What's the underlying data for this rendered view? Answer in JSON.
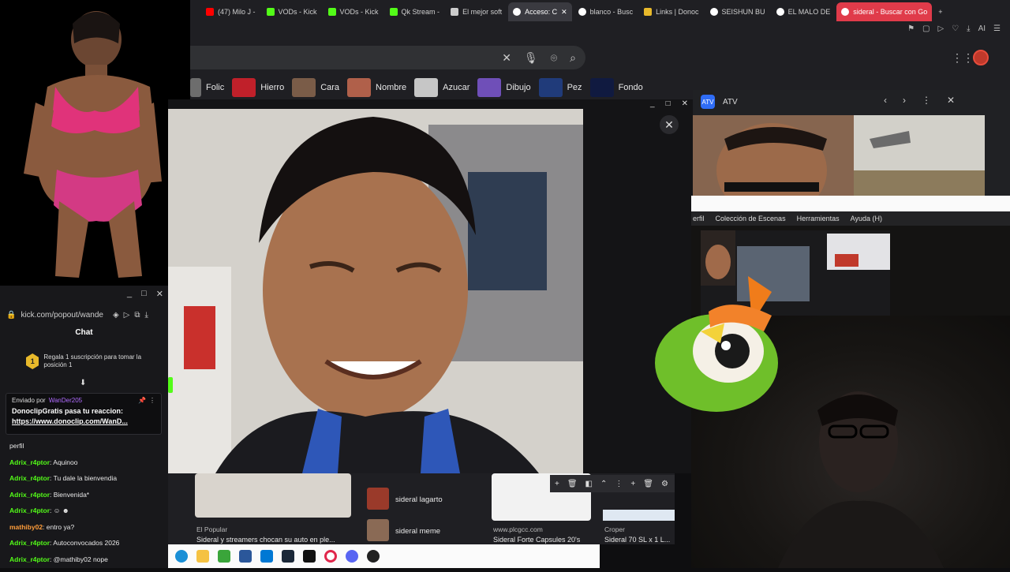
{
  "browser": {
    "tabs": [
      {
        "label": "(47) Milo J -",
        "color": "#ff0000"
      },
      {
        "label": "VODs - Kick",
        "color": "#53fc18"
      },
      {
        "label": "VODs - Kick",
        "color": "#53fc18"
      },
      {
        "label": "Qk Stream -",
        "color": "#53fc18"
      },
      {
        "label": "El mejor soft",
        "color": "#cccccc"
      },
      {
        "label": "Acceso: C",
        "color": "#ffffff"
      },
      {
        "label": "blanco - Busc",
        "color": "#ffffff"
      },
      {
        "label": "Links | Donoc",
        "color": "#e8b92b"
      },
      {
        "label": "SEISHUN BU",
        "color": "#ffffff"
      },
      {
        "label": "EL MALO DE",
        "color": "#ffffff"
      },
      {
        "label": "sideral - Buscar con Go",
        "color": "#ffffff"
      }
    ],
    "new_tab": "+",
    "toolbar_right": "AI",
    "search": {
      "clear": "✕",
      "mic": "🎙",
      "lens": "⌾",
      "search": "⌕"
    },
    "chips": [
      "Folic",
      "Hierro",
      "Cara",
      "Nombre",
      "Azucar",
      "Dibujo",
      "Pez",
      "Fondo"
    ],
    "chip_colors": [
      "#6d6d6d",
      "#c0202a",
      "#7a5c48",
      "#b0604a",
      "#c6c6c6",
      "#6f4fb8",
      "#203b7a",
      "#101a40"
    ]
  },
  "viewer": {
    "controls": [
      "_",
      "□",
      "✕"
    ],
    "close": "✕"
  },
  "atv": {
    "title": "ATV",
    "logo": "ATV",
    "controls": [
      "‹",
      "›",
      "⋮",
      "✕"
    ]
  },
  "obs": {
    "menu": [
      "erfil",
      "Colección de Escenas",
      "Herramientas",
      "Ayuda (H)"
    ]
  },
  "chat": {
    "window_controls": [
      "_",
      "□",
      "✕"
    ],
    "url": "kick.com/popout/wande",
    "title": "Chat",
    "sub_promo": {
      "badge": "1",
      "text": "Regala 1 suscripción para tomar la posición 1"
    },
    "pinned": {
      "sent_by_label": "Enviado por",
      "sender": "WanDer205",
      "message": "DonoclipGratis pasa tu reaccion:",
      "link": "https://www.donoclip.com/WanD..."
    },
    "partial_top": "perfil",
    "messages": [
      {
        "user": "Adrix_r4ptor",
        "text": "Aquinoo",
        "color": "green"
      },
      {
        "user": "Adrix_r4ptor",
        "text": "Tu dale la bienvendia",
        "color": "green"
      },
      {
        "user": "Adrix_r4ptor",
        "text": "Bienvenida*",
        "color": "green"
      },
      {
        "user": "Adrix_r4ptor",
        "text": "",
        "color": "green"
      },
      {
        "user": "mathiby02",
        "text": "entro ya?",
        "color": "orange"
      },
      {
        "user": "Adrix_r4ptor",
        "text": "Autoconvocados 2026",
        "color": "green"
      },
      {
        "user": "Adrix_r4ptor",
        "text": "@mathiby02 nope",
        "color": "green"
      }
    ]
  },
  "results": [
    {
      "source": "El Popular",
      "title": "Sideral y streamers chocan su auto en ple..."
    },
    {
      "source": "",
      "title": "sideral lagarto"
    },
    {
      "source": "",
      "title": "sideral meme"
    },
    {
      "source": "www.plcgcc.com",
      "title": "Sideral Forte Capsules 20's"
    },
    {
      "source": "Croper",
      "title": "Sideral 70 SL x 1 L..."
    }
  ],
  "taskbar": {
    "icons": [
      "edge-icon",
      "explorer-icon",
      "minecraft-icon",
      "calculator-icon",
      "outlook-icon",
      "steam-icon",
      "tiktok-icon",
      "opera-icon",
      "discord-icon",
      "obs-icon"
    ],
    "colors": [
      "#1a8fd6",
      "#f5c242",
      "#3aa53a",
      "#2b579a",
      "#0078d4",
      "#1b2838",
      "#111111",
      "#e0264a",
      "#5865f2",
      "#222222"
    ]
  }
}
